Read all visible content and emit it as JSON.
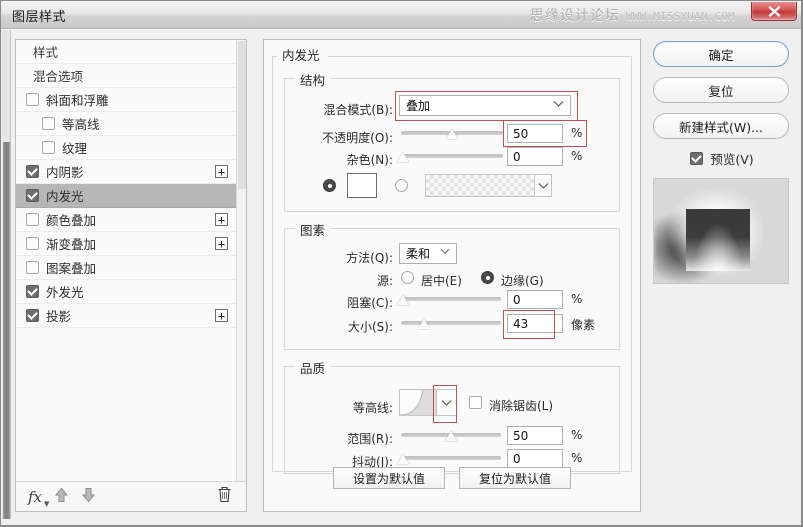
{
  "window": {
    "title": "图层样式",
    "watermark": "思缘设计论坛",
    "watermark_url": "WWW.MISSYUAN.COM",
    "close_label": "×"
  },
  "accent_red": "#c0504d",
  "sidebar": {
    "items": [
      {
        "label": "样式",
        "type": "plain",
        "checked": null,
        "plus": false,
        "selected": false,
        "indent": false
      },
      {
        "label": "混合选项",
        "type": "plain",
        "checked": null,
        "plus": false,
        "selected": false,
        "indent": false
      },
      {
        "label": "斜面和浮雕",
        "type": "check",
        "checked": false,
        "plus": false,
        "selected": false,
        "indent": false
      },
      {
        "label": "等高线",
        "type": "check",
        "checked": false,
        "plus": false,
        "selected": false,
        "indent": true
      },
      {
        "label": "纹理",
        "type": "check",
        "checked": false,
        "plus": false,
        "selected": false,
        "indent": true
      },
      {
        "label": "内阴影",
        "type": "check",
        "checked": true,
        "plus": true,
        "selected": false,
        "indent": false
      },
      {
        "label": "内发光",
        "type": "check",
        "checked": true,
        "plus": false,
        "selected": true,
        "indent": false
      },
      {
        "label": "颜色叠加",
        "type": "check",
        "checked": false,
        "plus": true,
        "selected": false,
        "indent": false
      },
      {
        "label": "渐变叠加",
        "type": "check",
        "checked": false,
        "plus": true,
        "selected": false,
        "indent": false
      },
      {
        "label": "图案叠加",
        "type": "check",
        "checked": false,
        "plus": false,
        "selected": false,
        "indent": false
      },
      {
        "label": "外发光",
        "type": "check",
        "checked": true,
        "plus": false,
        "selected": false,
        "indent": false
      },
      {
        "label": "投影",
        "type": "check",
        "checked": true,
        "plus": true,
        "selected": false,
        "indent": false
      }
    ],
    "toolbar": {
      "fx": "fx",
      "move_up": "▲",
      "move_down": "▼",
      "delete": "🗑"
    }
  },
  "main": {
    "section_title": "内发光",
    "structure": {
      "legend": "结构",
      "blend_mode_label": "混合模式(B):",
      "blend_mode_value": "叠加",
      "opacity_label": "不透明度(O):",
      "opacity_value": "50",
      "opacity_unit": "%",
      "noise_label": "杂色(N):",
      "noise_value": "0",
      "noise_unit": "%",
      "fill_type": "color",
      "color_value": "#ffffff"
    },
    "elements": {
      "legend": "图素",
      "technique_label": "方法(Q):",
      "technique_value": "柔和",
      "source_label": "源:",
      "source_center_label": "居中(E)",
      "source_edge_label": "边缘(G)",
      "source_value": "edge",
      "choke_label": "阻塞(C):",
      "choke_value": "0",
      "choke_unit": "%",
      "size_label": "大小(S):",
      "size_value": "43",
      "size_unit": "像素"
    },
    "quality": {
      "legend": "品质",
      "contour_label": "等高线:",
      "antialias_label": "消除锯齿(L)",
      "antialias_checked": false,
      "range_label": "范围(R):",
      "range_value": "50",
      "range_unit": "%",
      "jitter_label": "抖动(J):",
      "jitter_value": "0",
      "jitter_unit": "%"
    },
    "make_default_label": "设置为默认值",
    "reset_default_label": "复位为默认值"
  },
  "right": {
    "ok_label": "确定",
    "reset_label": "复位",
    "new_style_label": "新建样式(W)...",
    "preview_label": "预览(V)",
    "preview_checked": true
  }
}
